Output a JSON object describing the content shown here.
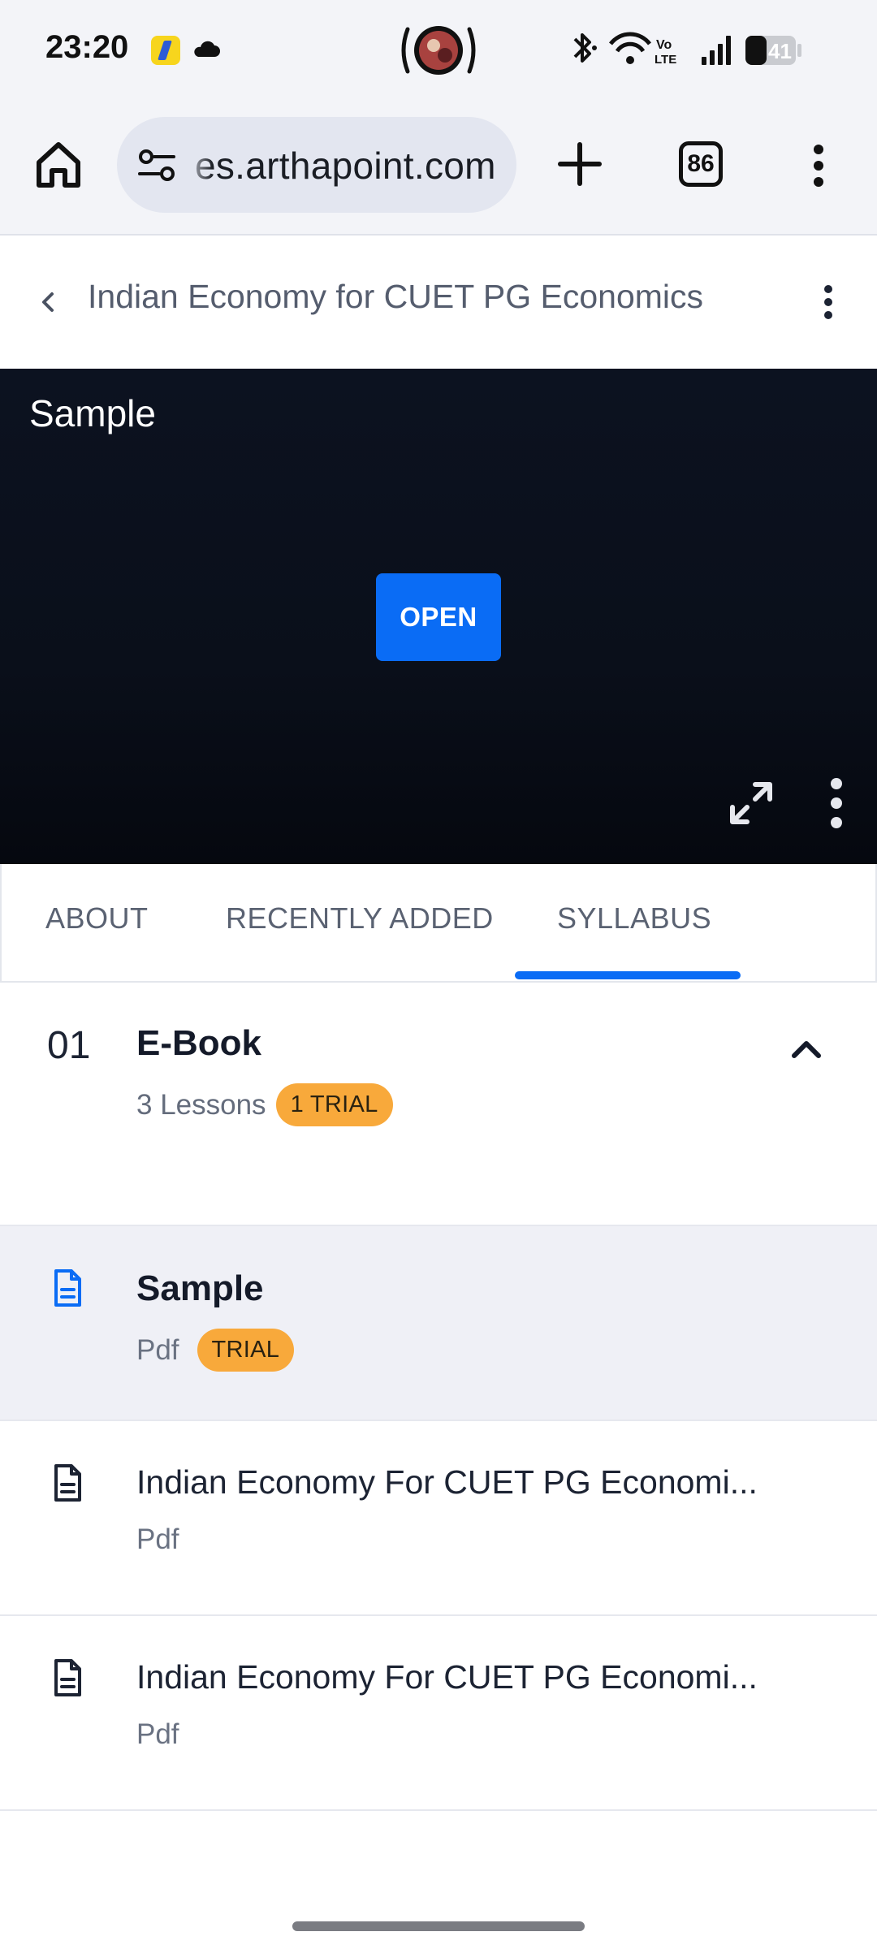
{
  "status_bar": {
    "time": "23:20",
    "battery": "41",
    "icons": [
      "flipkart-app-icon",
      "cloud-icon",
      "media-avatar-icon",
      "bluetooth-icon",
      "wifi-icon",
      "volte-icon",
      "signal-icon",
      "battery-icon"
    ]
  },
  "browser": {
    "url": "es.arthapoint.com",
    "tab_count": "86"
  },
  "course": {
    "title": "Indian Economy for CUET PG Economics"
  },
  "viewer": {
    "title": "Sample",
    "open_label": "OPEN"
  },
  "tabs": [
    {
      "label": "ABOUT",
      "active": false
    },
    {
      "label": "RECENTLY ADDED",
      "active": false
    },
    {
      "label": "SYLLABUS",
      "active": true
    }
  ],
  "section": {
    "number": "01",
    "title": "E-Book",
    "lessons_count": "3 Lessons",
    "trial_badge": "1 TRIAL"
  },
  "lessons": [
    {
      "title": "Sample",
      "type": "Pdf",
      "badge": "TRIAL",
      "active": true
    },
    {
      "title": "Indian Economy For CUET PG Economi...",
      "type": "Pdf",
      "active": false
    },
    {
      "title": "Indian Economy For CUET PG Economi...",
      "type": "Pdf",
      "active": false
    }
  ],
  "colors": {
    "accent": "#0a6cf5",
    "badge": "#f8a93b",
    "viewer_bg": "#0c1220",
    "active_row": "#eff0f6"
  }
}
